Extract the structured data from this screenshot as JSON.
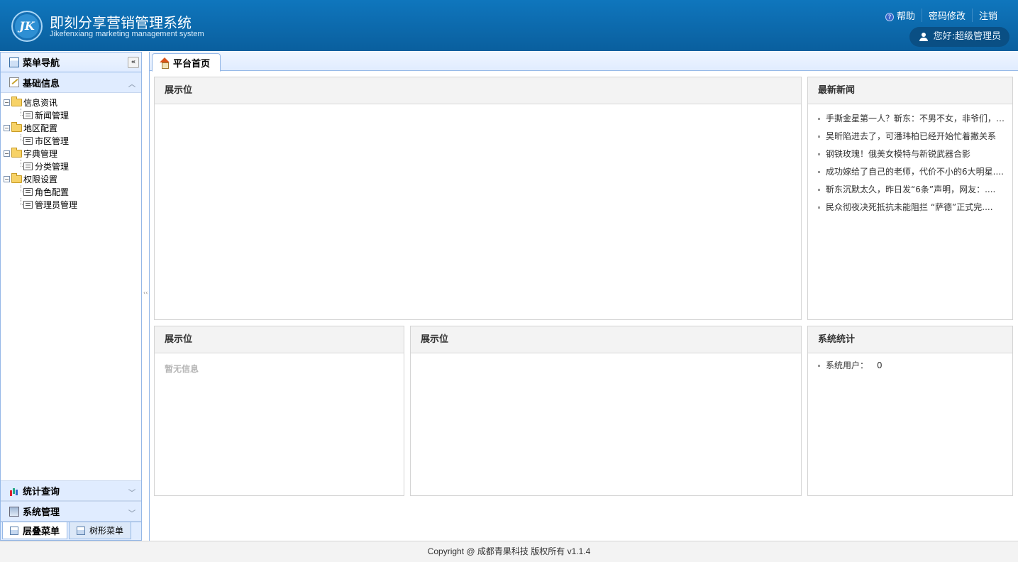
{
  "header": {
    "logo_text": "JK",
    "title": "即刻分享营销管理系统",
    "subtitle": "Jikefenxiang marketing management system",
    "links": {
      "help": "帮助",
      "change_password": "密码修改",
      "logout": "注销"
    },
    "greeting": "您好:超级管理员"
  },
  "sidebar": {
    "header": "菜单导航",
    "sections": [
      {
        "label": "基础信息",
        "expanded": true
      },
      {
        "label": "统计查询",
        "expanded": false
      },
      {
        "label": "系统管理",
        "expanded": false
      }
    ],
    "tree": [
      {
        "label": "信息资讯",
        "children": [
          "新闻管理"
        ]
      },
      {
        "label": "地区配置",
        "children": [
          "市区管理"
        ]
      },
      {
        "label": "字典管理",
        "children": [
          "分类管理"
        ]
      },
      {
        "label": "权限设置",
        "children": [
          "角色配置",
          "管理员管理"
        ]
      }
    ],
    "tabs": {
      "cascade": "层叠菜单",
      "tree": "树形菜单"
    }
  },
  "main": {
    "tab_label": "平台首页",
    "panels": {
      "display1": {
        "title": "展示位"
      },
      "news": {
        "title": "最新新闻",
        "items": [
          "手撕金星第一人？靳东：不男不女，非爷们，....",
          "吴昕陷进去了，可潘玮柏已经开始忙着撇关系",
          "钢铁玫瑰！俄美女模特与新锐武器合影",
          "成功嫁给了自己的老师，代价不小的6大明星....",
          "靳东沉默太久，昨日发“6条”声明，网友：....",
          "民众彻夜决死抵抗未能阻拦 “萨德”正式完...."
        ]
      },
      "display2": {
        "title": "展示位",
        "empty": "暂无信息"
      },
      "display3": {
        "title": "展示位"
      },
      "stats": {
        "title": "系统统计",
        "label": "系统用户：",
        "value": "0"
      }
    }
  },
  "footer": {
    "text": "Copyright @ 成都青果科技 版权所有 v1.1.4"
  }
}
